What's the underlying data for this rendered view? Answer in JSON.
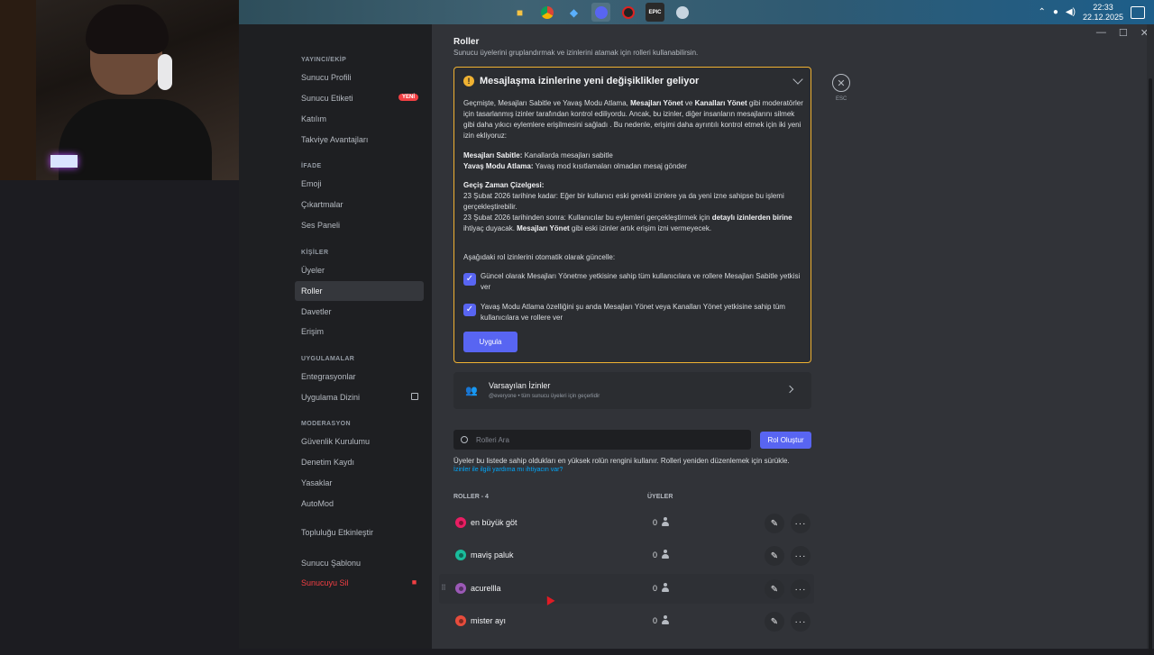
{
  "taskbar": {
    "icons": [
      "folder-icon",
      "chrome-icon",
      "app-icon",
      "discord-icon",
      "obs-icon",
      "epic-icon",
      "steam-icon"
    ],
    "time": "22:33",
    "date": "22.12.2025"
  },
  "sidebar": {
    "sections": {
      "publisher": "YAYINCI/EKİP",
      "expression": "İFADE",
      "people": "KİŞİLER",
      "apps": "UYGULAMALAR",
      "moderation": "MODERASYON"
    },
    "items": {
      "server_profile": "Sunucu Profili",
      "server_tag": "Sunucu Etiketi",
      "new_badge": "YENİ",
      "engagement": "Katılım",
      "boost_perks": "Takviye Avantajları",
      "emoji": "Emoji",
      "stickers": "Çıkartmalar",
      "soundboard": "Ses Paneli",
      "members": "Üyeler",
      "roles": "Roller",
      "invites": "Davetler",
      "access": "Erişim",
      "integrations": "Entegrasyonlar",
      "app_directory": "Uygulama Dizini",
      "safety_setup": "Güvenlik Kurulumu",
      "audit_log": "Denetim Kaydı",
      "bans": "Yasaklar",
      "automod": "AutoMod",
      "enable_community": "Topluluğu Etkinleştir",
      "server_template": "Sunucu Şablonu",
      "delete_server": "Sunucuyu Sil"
    }
  },
  "main": {
    "title": "Roller",
    "subtitle": "Sunucu üyelerini gruplandırmak ve izinlerini atamak için rolleri kullanabilirsin.",
    "notice": {
      "title": "Mesajlaşma izinlerine yeni değişiklikler geliyor",
      "p1_a": "Geçmişte, Mesajları Sabitle ve Yavaş Modu Atlama, ",
      "p1_b": "Mesajları Yönet",
      "p1_c": " ve ",
      "p1_d": "Kanalları Yönet",
      "p1_e": " gibi moderatörler için tasarlanmış izinler tarafından kontrol ediliyordu. Ancak, bu izinler, diğer insanların mesajlarını silmek gibi daha yıkıcı eylemlere erişilmesini sağladı . Bu nedenle, erişimi daha ayrıntılı kontrol etmek için iki yeni izin ekliyoruz:",
      "pin_label": "Mesajları Sabitle:",
      "pin_text": " Kanallarda mesajları sabitle",
      "slow_label": "Yavaş Modu Atlama:",
      "slow_text": " Yavaş mod kısıtlamaları olmadan mesaj gönder",
      "timeline_label": "Geçiş Zaman Çizelgesi:",
      "timeline_1": "23 Şubat 2026 tarihine kadar: Eğer bir kullanıcı eski gerekli izinlere ya da yeni izne sahipse bu işlemi gerçekleştirebilir.",
      "timeline_2a": "23 Şubat 2026 tarihinden sonra: Kullanıcılar bu eylemleri gerçekleştirmek için ",
      "timeline_2b": "detaylı izinlerden birine",
      "timeline_2c": " ihtiyaç duyacak. ",
      "timeline_2d": "Mesajları Yönet",
      "timeline_2e": " gibi eski izinler artık erişim izni vermeyecek.",
      "auto_update": "Aşağıdaki rol izinlerini otomatik olarak güncelle:",
      "checkbox_1": "Güncel olarak Mesajları Yönetme yetkisine sahip tüm kullanıcılara ve rollere Mesajları Sabitle yetkisi ver",
      "checkbox_2": "Yavaş Modu Atlama özelliğini şu anda Mesajları Yönet veya Kanalları Yönet yetkisine sahip tüm kullanıcılara ve rollere ver",
      "apply": "Uygula"
    },
    "esc_label": "ESC",
    "default_perms": {
      "title": "Varsayılan İzinler",
      "subtitle": "@everyone • tüm sunucu üyeleri için geçerlidir"
    },
    "search_placeholder": "Rolleri Ara",
    "create_role": "Rol Oluştur",
    "hint": "Üyeler bu listede sahip oldukları en yüksek rolün rengini kullanır. Rolleri yeniden düzenlemek için sürükle.",
    "hint_link": "İzinler ile ilgili yardıma mı ihtiyacın var?",
    "col_roles": "ROLLER - 4",
    "col_members": "ÜYELER",
    "roles": [
      {
        "name": "en büyük göt",
        "count": "0",
        "color": "#e91e63"
      },
      {
        "name": "maviş paluk",
        "count": "0",
        "color": "#1abc9c"
      },
      {
        "name": "acurellla",
        "count": "0",
        "color": "#9b59b6"
      },
      {
        "name": "mister ayı",
        "count": "0",
        "color": "#e74c3c"
      }
    ]
  }
}
